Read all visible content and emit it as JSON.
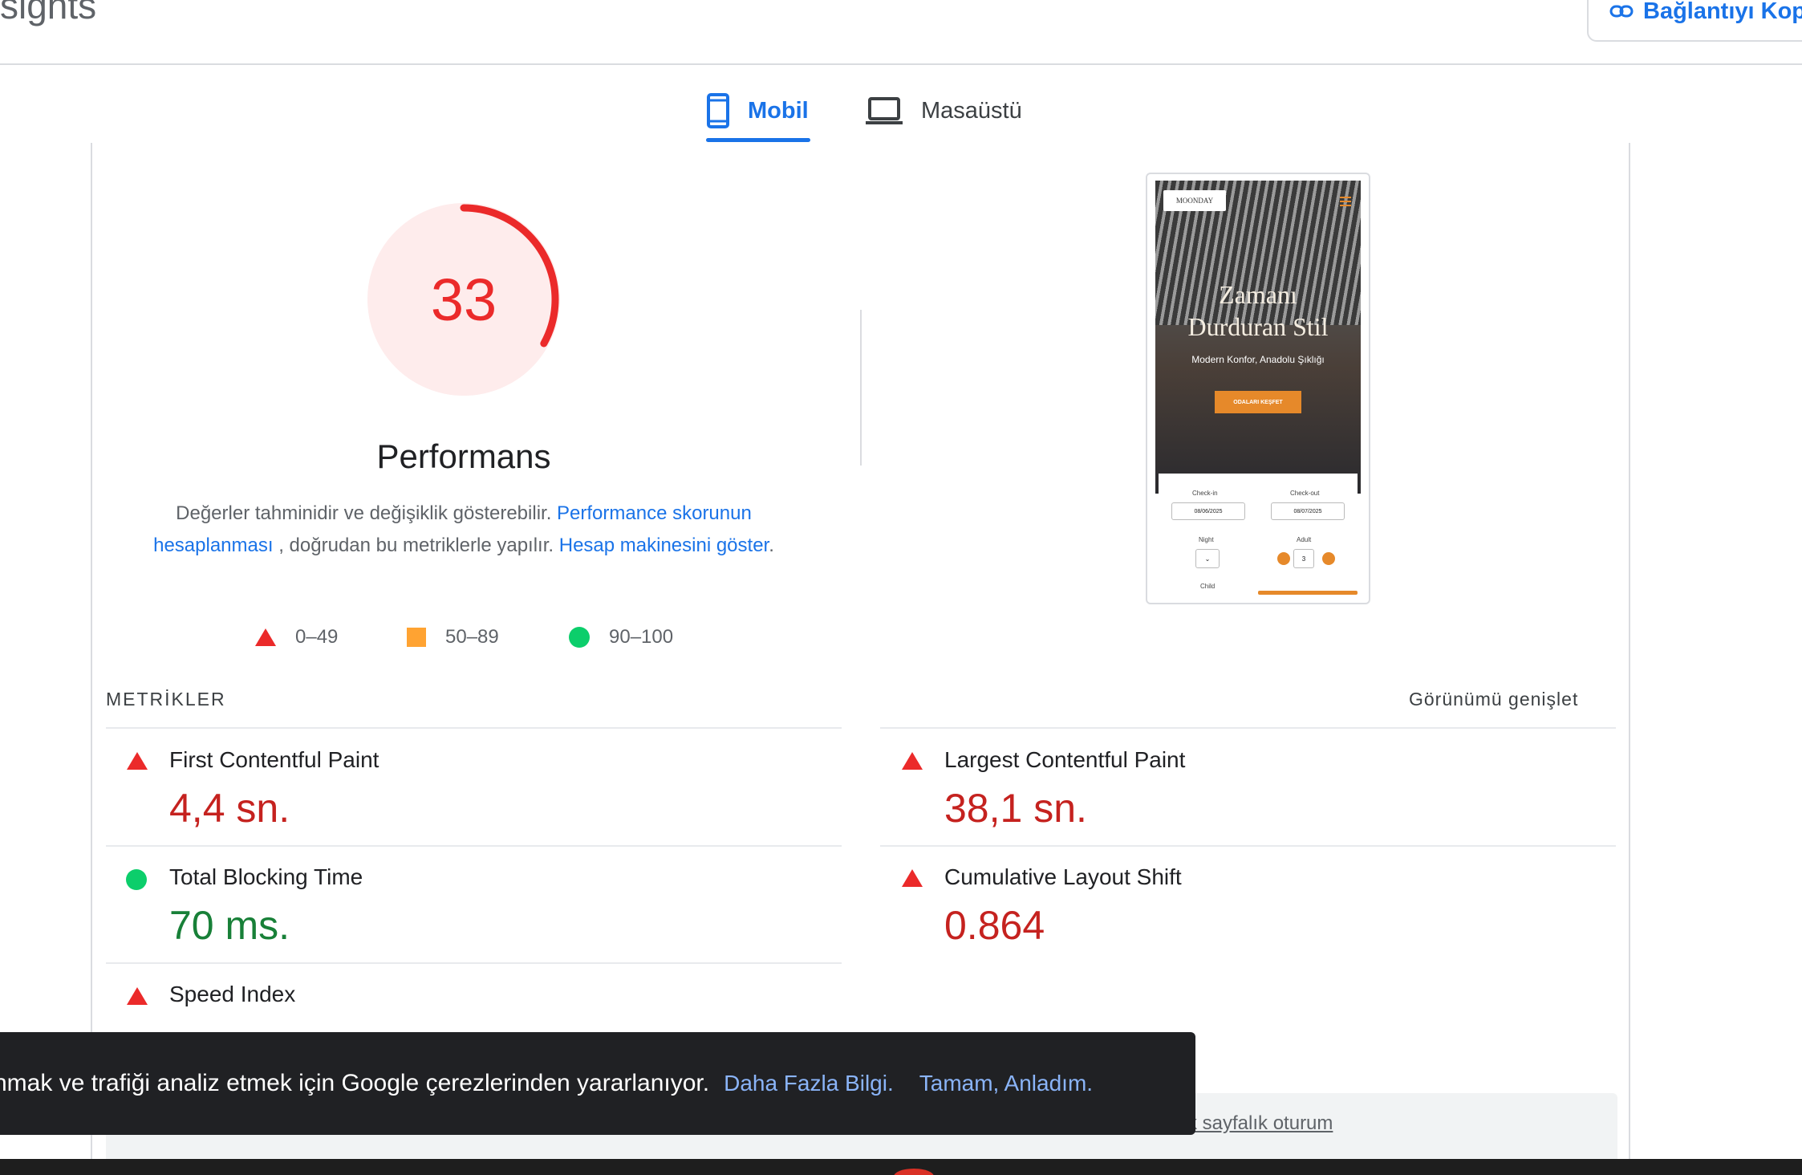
{
  "header": {
    "title_partial": "sights",
    "copy_link_label": "Bağlantıyı Kopy"
  },
  "tabs": [
    {
      "label": "Mobil",
      "icon": "smartphone-icon",
      "active": true
    },
    {
      "label": "Masaüstü",
      "icon": "laptop-icon",
      "active": false
    }
  ],
  "score": {
    "value": "33",
    "fraction": 0.33,
    "title": "Performans",
    "desc_text_1": "Değerler tahminidir ve değişiklik gösterebilir.",
    "desc_link_1": "Performance skorunun hesaplanması",
    "desc_text_2": ", doğrudan bu metriklerle yapılır.",
    "desc_link_2": "Hesap makinesini göster",
    "desc_end": ".",
    "color": "#eb2a2a"
  },
  "legend": [
    {
      "shape": "triangle",
      "range": "0–49",
      "color": "#eb2a2a"
    },
    {
      "shape": "square",
      "range": "50–89",
      "color": "#ffa332"
    },
    {
      "shape": "circle",
      "range": "90–100",
      "color": "#0cce6b"
    }
  ],
  "preview": {
    "logo": "MOONDAY",
    "headline_1": "Zamanı",
    "headline_2": "Durduran Stil",
    "subtitle": "Modern Konfor, Anadolu Şıklığı",
    "cta": "ODALARI KEŞFET",
    "checkin_label": "Check-in",
    "checkout_label": "Check-out",
    "checkin_value": "08/06/2025",
    "checkout_value": "08/07/2025",
    "night_label": "Night",
    "adult_label": "Adult",
    "adult_value": "3",
    "child_label": "Child"
  },
  "metrics": {
    "section_label": "METRİKLER",
    "expand_label": "Görünümü genişlet",
    "items": [
      {
        "name": "First Contentful Paint",
        "value": "4,4 sn.",
        "status": "poor"
      },
      {
        "name": "Largest Contentful Paint",
        "value": "38,1 sn.",
        "status": "poor"
      },
      {
        "name": "Total Blocking Time",
        "value": "70 ms.",
        "status": "good"
      },
      {
        "name": "Cumulative Layout Shift",
        "value": "0.864",
        "status": "poor"
      },
      {
        "name": "Speed Index",
        "value": "",
        "status": "poor"
      }
    ]
  },
  "cookie": {
    "message": "nmak ve trafiği analiz etmek için Google çerezlerinden yararlanıyor.",
    "more_info": "Daha Fazla Bilgi.",
    "ok": "Tamam, Anladım."
  },
  "footer_partial": {
    "session_text": "k sayfalık oturum"
  }
}
